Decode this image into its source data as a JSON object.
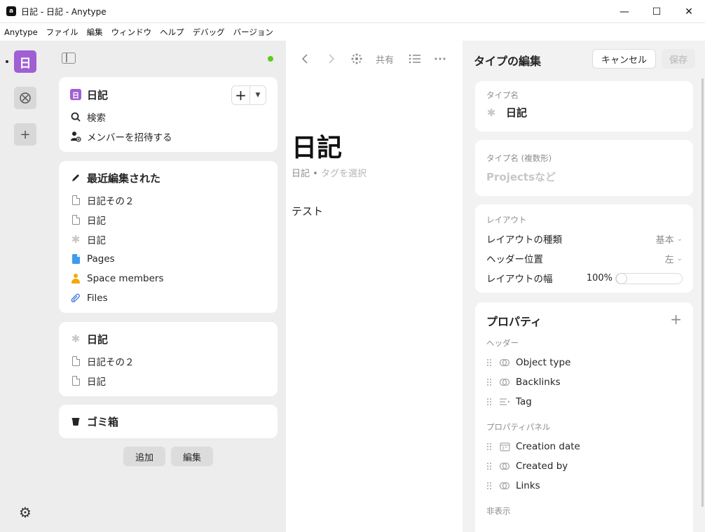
{
  "window": {
    "title": "日記 - 日記 - Anytype",
    "app_logo": "a",
    "minimize_icon": "—",
    "maximize_icon": "☐",
    "close_icon": "✕"
  },
  "menubar": {
    "items": [
      "Anytype",
      "ファイル",
      "編集",
      "ウィンドウ",
      "ヘルプ",
      "デバッグ",
      "バージョン"
    ]
  },
  "rail": {
    "space_letter": "日",
    "add_icon": "+",
    "gear_icon": "⚙"
  },
  "sidebar": {
    "space": {
      "letter": "日",
      "name": "日記",
      "search": "検索",
      "invite": "メンバーを招待する"
    },
    "recent": {
      "header": "最近編集された",
      "items": [
        "日記その２",
        "日記",
        "日記",
        "Pages",
        "Space members",
        "Files"
      ]
    },
    "widget": {
      "header": "日記",
      "items": [
        "日記その２",
        "日記"
      ]
    },
    "bin": {
      "header": "ゴミ箱"
    },
    "add_button": "追加",
    "edit_button": "編集"
  },
  "editor": {
    "share_label": "共有",
    "title": "日記",
    "type_label": "日記",
    "meta_sep": "•",
    "tag_placeholder": "タグを選択",
    "body_text": "テスト"
  },
  "type_editor": {
    "title": "タイプの編集",
    "cancel_label": "キャンセル",
    "save_label": "保存",
    "name_label": "タイプ名",
    "name_value": "日記",
    "plural_label": "タイプ名 (複数形)",
    "plural_placeholder": "Projectsなど",
    "layout": {
      "section": "レイアウト",
      "type_label": "レイアウトの種類",
      "type_value": "基本",
      "header_label": "ヘッダー位置",
      "header_value": "左",
      "width_label": "レイアウトの幅",
      "width_value": "100%",
      "width_level": 0
    },
    "properties": {
      "title": "プロパティ",
      "add_icon": "+",
      "header_section": "ヘッダー",
      "header_items": [
        {
          "label": "Object type",
          "icon": "link-icon"
        },
        {
          "label": "Backlinks",
          "icon": "link-icon"
        },
        {
          "label": "Tag",
          "icon": "tag-list-icon"
        }
      ],
      "panel_section": "プロパティパネル",
      "panel_items": [
        {
          "label": "Creation date",
          "icon": "calendar-icon"
        },
        {
          "label": "Created by",
          "icon": "link-icon"
        },
        {
          "label": "Links",
          "icon": "link-icon"
        }
      ],
      "hidden_section": "非表示"
    }
  }
}
